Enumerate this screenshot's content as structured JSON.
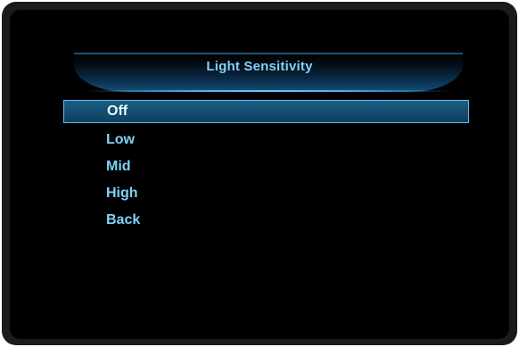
{
  "menu": {
    "title": "Light Sensitivity",
    "items": [
      {
        "label": "Off",
        "selected": true
      },
      {
        "label": "Low",
        "selected": false
      },
      {
        "label": "Mid",
        "selected": false
      },
      {
        "label": "High",
        "selected": false
      },
      {
        "label": "Back",
        "selected": false
      }
    ]
  },
  "colors": {
    "text": "#7fd2f5",
    "selected_text": "#e9f8ff",
    "highlight": "#1b5e86",
    "border": "#5cc0ea",
    "background": "#000000"
  }
}
